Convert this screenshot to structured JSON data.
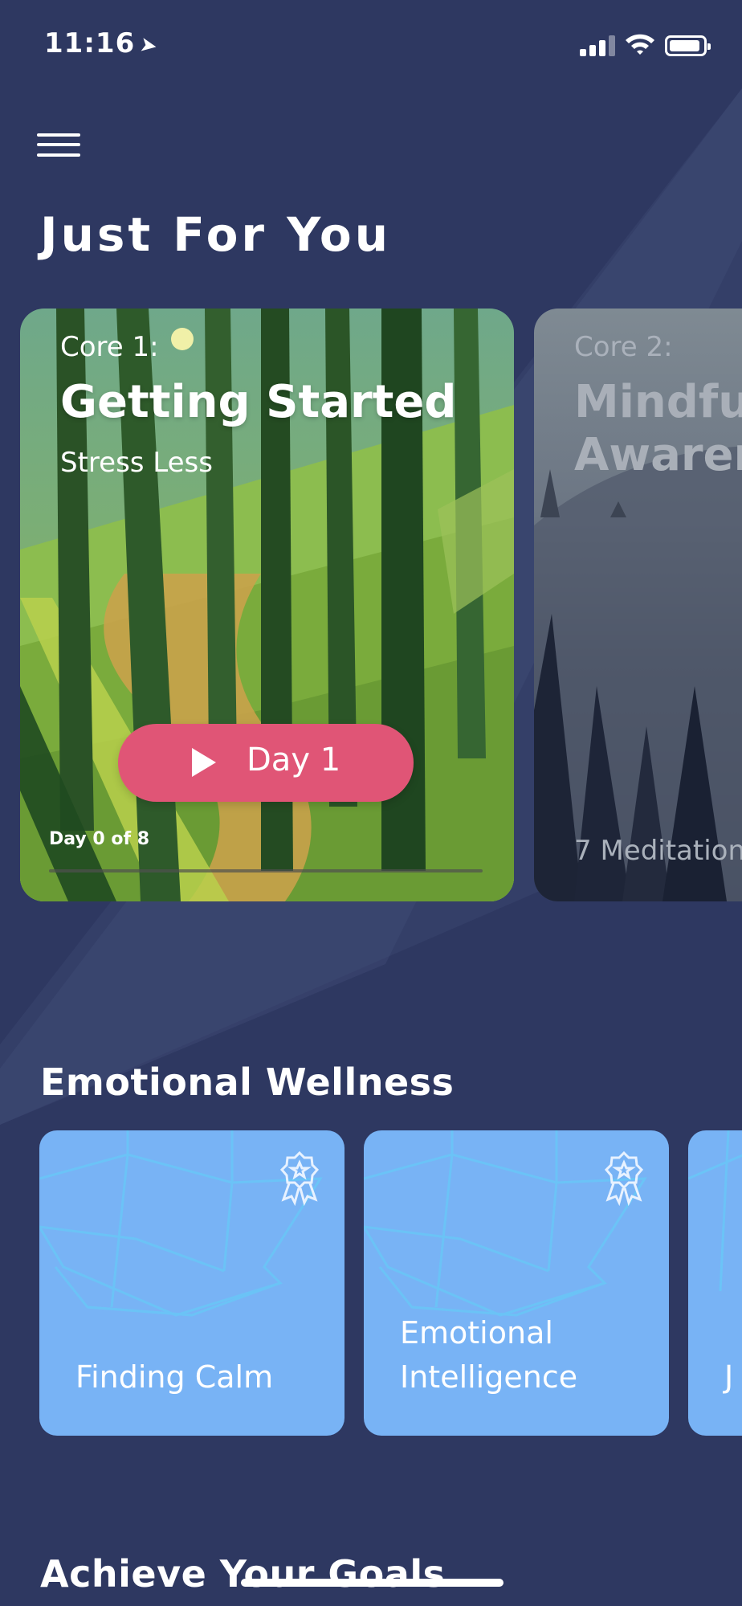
{
  "status_bar": {
    "time": "11:16",
    "location_icon": "location-arrow-icon",
    "signal_icon": "cellular-signal-icon",
    "wifi_icon": "wifi-icon",
    "battery_icon": "battery-icon"
  },
  "header": {
    "menu_icon": "hamburger-menu-icon"
  },
  "just_for_you": {
    "title": "Just For You",
    "cards": [
      {
        "course": "Core 1:",
        "title": "Getting Started",
        "subtitle": "Stress Less",
        "button_label": "Day 1",
        "progress_text": "Day 0 of 8",
        "progress": 0
      },
      {
        "course": "Core 2:",
        "title_line1": "Mindfu",
        "title_line2": "Awaren",
        "footer": "7 Meditation"
      }
    ]
  },
  "emotional_wellness": {
    "title": "Emotional Wellness",
    "tiles": [
      {
        "lines": [
          "Finding Calm"
        ],
        "badge_icon": "award-ribbon-icon"
      },
      {
        "lines": [
          "Emotional",
          "Intelligence"
        ],
        "badge_icon": "award-ribbon-icon"
      },
      {
        "lines": [
          "J"
        ]
      }
    ]
  },
  "achieve_goals": {
    "title": "Achieve Your Goals"
  },
  "colors": {
    "background": "#2e3861",
    "button": "#e05576",
    "tile": "#78b3f5"
  }
}
